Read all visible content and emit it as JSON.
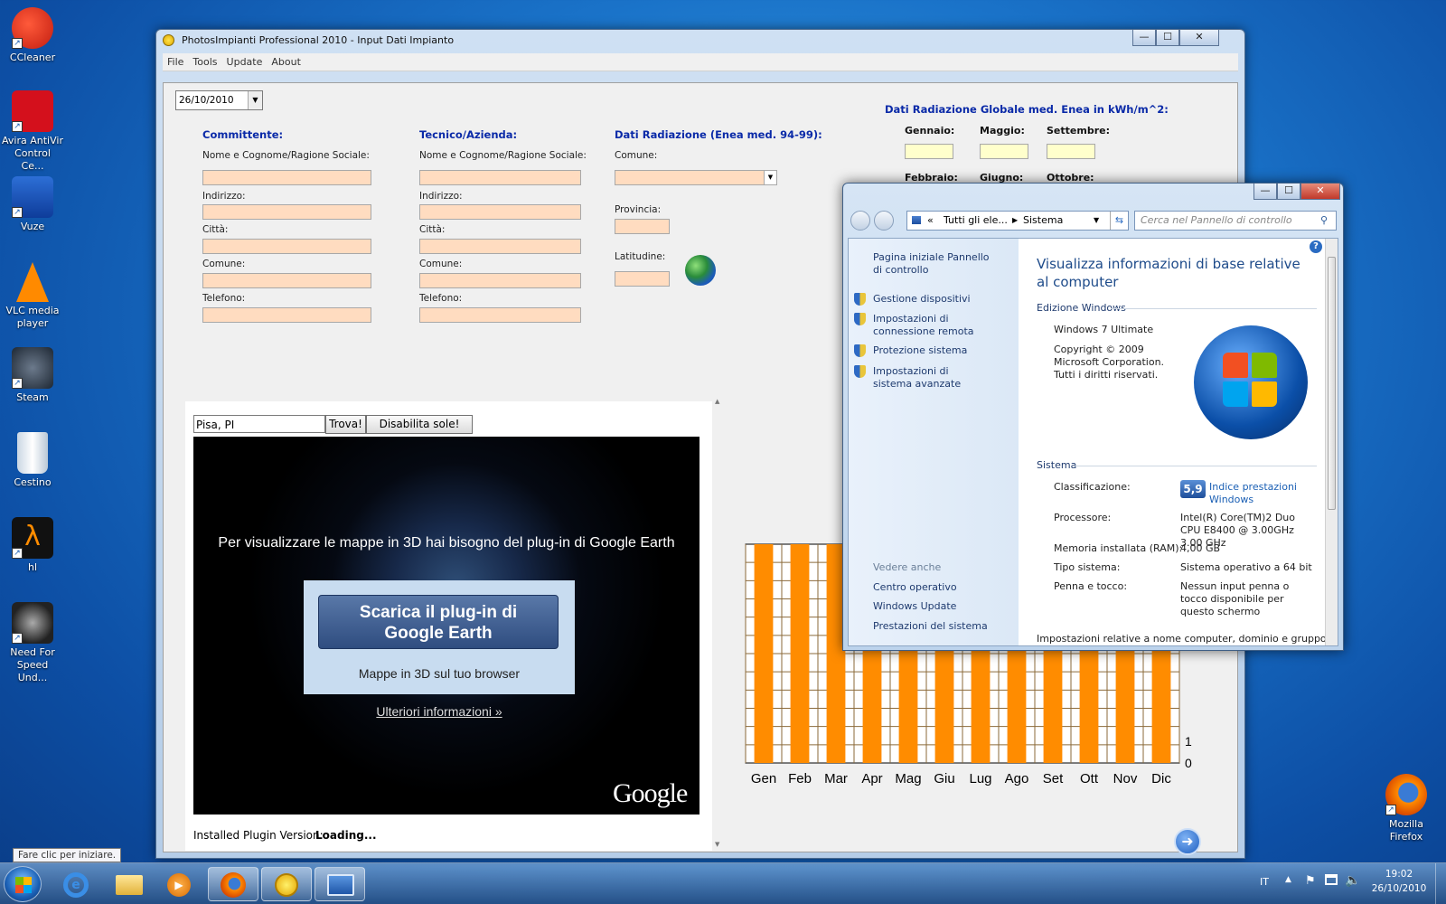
{
  "desktop": {
    "icons": [
      {
        "label": "CCleaner"
      },
      {
        "label": "Avira AntiVir Control Ce..."
      },
      {
        "label": "Vuze"
      },
      {
        "label": "VLC media player"
      },
      {
        "label": "Steam"
      },
      {
        "label": "Cestino"
      },
      {
        "label": "hl"
      },
      {
        "label": "Need For Speed Und..."
      },
      {
        "label": "Mozilla Firefox"
      }
    ],
    "tooltip": "Fare clic per iniziare."
  },
  "main_window": {
    "title": "PhotosImpianti Professional 2010 - Input Dati Impianto",
    "menu": [
      "File",
      "Tools",
      "Update",
      "About"
    ],
    "date": "26/10/2010",
    "committente": {
      "title": "Committente:",
      "fields": [
        "Nome e Cognome/Ragione Sociale:",
        "Indirizzo:",
        "Città:",
        "Comune:",
        "Telefono:"
      ]
    },
    "tecnico": {
      "title": "Tecnico/Azienda:",
      "fields": [
        "Nome e Cognome/Ragione Sociale:",
        "Indirizzo:",
        "Città:",
        "Comune:",
        "Telefono:"
      ]
    },
    "radiazione": {
      "title": "Dati Radiazione (Enea med. 94-99):",
      "comune": "Comune:",
      "provincia": "Provincia:",
      "latitudine": "Latitudine:"
    },
    "globale": {
      "title": "Dati Radiazione Globale med. Enea in kWh/m^2:",
      "months": [
        "Gennaio:",
        "Maggio:",
        "Settembre:",
        "Febbraio:",
        "Giugno:",
        "Ottobre:"
      ]
    },
    "map": {
      "search_value": "Pisa, PI",
      "find_button": "Trova!",
      "sun_button": "Disabilita sole!",
      "message": "Per visualizzare le mappe in 3D hai bisogno del plug-in di Google Earth",
      "download_button": "Scarica il plug-in di Google Earth",
      "download_sub": "Mappe in 3D sul tuo browser",
      "more_info": "Ulteriori informazioni »",
      "brand": "Google",
      "plugin_label": "Installed Plugin Version:",
      "plugin_status": "Loading..."
    }
  },
  "chart_data": {
    "type": "bar",
    "categories": [
      "Gen",
      "Feb",
      "Mar",
      "Apr",
      "Mag",
      "Giu",
      "Lug",
      "Ago",
      "Set",
      "Ott",
      "Nov",
      "Dic"
    ],
    "values": [
      6,
      6,
      6,
      6,
      6,
      6,
      6,
      6,
      6,
      6,
      6,
      6
    ],
    "ytick_labels": [
      "0",
      "1"
    ],
    "color": "#ff8c00",
    "grid": true
  },
  "system_window": {
    "address": [
      "«",
      "Tutti gli ele...",
      "Sistema"
    ],
    "search_placeholder": "Cerca nel Pannello di controllo",
    "side_links": {
      "home": "Pagina iniziale Pannello di controllo",
      "items": [
        "Gestione dispositivi",
        "Impostazioni di connessione remota",
        "Protezione sistema",
        "Impostazioni di sistema avanzate"
      ],
      "see_also_title": "Vedere anche",
      "see_also": [
        "Centro operativo",
        "Windows Update",
        "Prestazioni del sistema"
      ]
    },
    "heading": "Visualizza informazioni di base relative al computer",
    "edition_section": "Edizione Windows",
    "edition": "Windows 7 Ultimate",
    "copyright": "Copyright © 2009 Microsoft Corporation. Tutti i diritti riservati.",
    "system_section": "Sistema",
    "rows": [
      {
        "key": "Classificazione:",
        "value": "Indice prestazioni Windows"
      },
      {
        "key": "Processore:",
        "value": "Intel(R) Core(TM)2 Duo CPU E8400 @ 3.00GHz 3.00 GHz"
      },
      {
        "key": "Memoria installata (RAM):",
        "value": "4,00 GB"
      },
      {
        "key": "Tipo sistema:",
        "value": "Sistema operativo a 64 bit"
      },
      {
        "key": "Penna e tocco:",
        "value": "Nessun input penna o tocco disponibile per questo schermo"
      }
    ],
    "score": "5,9",
    "footer": "Impostazioni relative a nome computer, dominio e gruppo di"
  },
  "taskbar": {
    "lang": "IT",
    "time": "19:02",
    "date": "26/10/2010"
  }
}
